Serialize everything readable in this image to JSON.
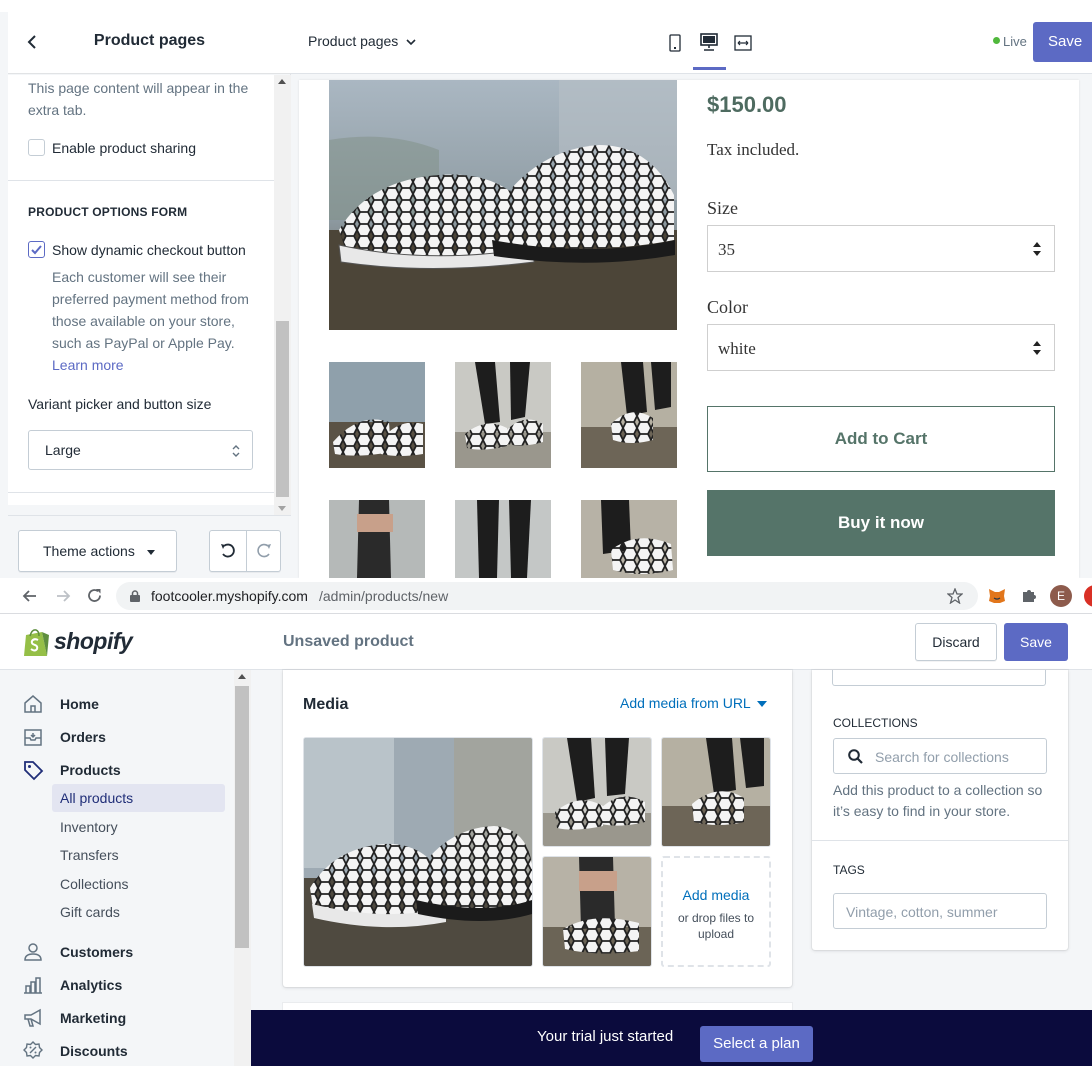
{
  "editor": {
    "panel_title": "Product pages",
    "extra_tab_text": "This page content will appear in the extra tab.",
    "enable_sharing_label": "Enable product sharing",
    "product_options_heading": "PRODUCT OPTIONS FORM",
    "dynamic_checkout_label": "Show dynamic checkout button",
    "dynamic_checkout_help": "Each customer will see their preferred payment method from those available on your store, such as PayPal or Apple Pay.",
    "learn_more": "Learn more",
    "variant_picker_label": "Variant picker and button size",
    "variant_picker_value": "Large",
    "theme_actions_label": "Theme actions",
    "page_selector_label": "Product pages",
    "live_label": "Live",
    "save_label": "Save",
    "colors": {
      "accent": "#5c6ac4",
      "live_dot": "#50b83c",
      "buy_now": "#557469"
    }
  },
  "preview": {
    "price": "$150.00",
    "tax_note": "Tax included.",
    "size_label": "Size",
    "size_value": "35",
    "color_label": "Color",
    "color_value": "white",
    "add_to_cart": "Add to Cart",
    "buy_now": "Buy it now"
  },
  "browser": {
    "url_host": "footcooler.myshopify.com",
    "url_path": "/admin/products/new",
    "profile_initial": "E"
  },
  "admin": {
    "logo_text": "shopify",
    "page_title": "Unsaved product",
    "discard_label": "Discard",
    "save_label": "Save",
    "nav": [
      {
        "label": "Home",
        "icon": "home-icon"
      },
      {
        "label": "Orders",
        "icon": "orders-icon"
      },
      {
        "label": "Products",
        "icon": "tag-icon"
      },
      {
        "label": "Customers",
        "icon": "customer-icon"
      },
      {
        "label": "Analytics",
        "icon": "analytics-icon"
      },
      {
        "label": "Marketing",
        "icon": "megaphone-icon"
      },
      {
        "label": "Discounts",
        "icon": "discount-icon"
      }
    ],
    "sub_nav": [
      "All products",
      "Inventory",
      "Transfers",
      "Collections",
      "Gift cards"
    ],
    "media": {
      "title": "Media",
      "add_from_url": "Add media from URL",
      "add_media": "Add media",
      "drop_hint": "or drop files to upload"
    },
    "collections": {
      "heading": "COLLECTIONS",
      "placeholder": "Search for collections",
      "help": "Add this product to a collection so it’s easy to find in your store."
    },
    "tags": {
      "heading": "TAGS",
      "placeholder": "Vintage, cotton, summer"
    },
    "trial": {
      "text": "Your trial just started",
      "button": "Select a plan"
    }
  }
}
